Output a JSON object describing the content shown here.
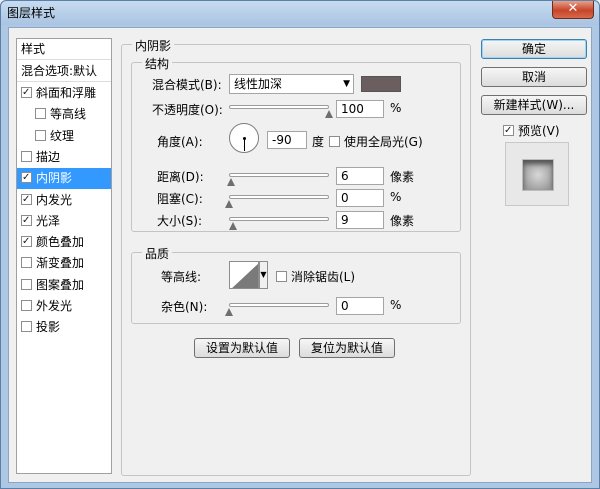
{
  "window": {
    "title": "图层样式",
    "close_glyph": "✕"
  },
  "style_list": {
    "header": "样式",
    "blend_options": "混合选项:默认",
    "items": [
      {
        "label": "斜面和浮雕",
        "checked": true
      },
      {
        "label": "等高线",
        "checked": false
      },
      {
        "label": "纹理",
        "checked": false
      },
      {
        "label": "描边",
        "checked": false
      },
      {
        "label": "内阴影",
        "checked": true
      },
      {
        "label": "内发光",
        "checked": true
      },
      {
        "label": "光泽",
        "checked": true
      },
      {
        "label": "颜色叠加",
        "checked": true
      },
      {
        "label": "渐变叠加",
        "checked": false
      },
      {
        "label": "图案叠加",
        "checked": false
      },
      {
        "label": "外发光",
        "checked": false
      },
      {
        "label": "投影",
        "checked": false
      }
    ]
  },
  "buttons": {
    "ok": "确定",
    "cancel": "取消",
    "new_style": "新建样式(W)...",
    "preview": "预览(V)",
    "preview_checked": true
  },
  "inner_shadow": {
    "title": "内阴影",
    "structure": {
      "title": "结构",
      "blend_mode_label": "混合模式(B):",
      "blend_mode_value": "线性加深",
      "shadow_color": "#6a5e5e",
      "opacity_label": "不透明度(O):",
      "opacity_value": "100",
      "opacity_fraction": 1.0,
      "opacity_unit": "%",
      "angle_label": "角度(A):",
      "angle_value": "-90",
      "angle_unit": "度",
      "global_light_label": "使用全局光(G)",
      "global_light_checked": false,
      "distance_label": "距离(D):",
      "distance_value": "6",
      "distance_fraction": 0.02,
      "distance_unit": "像素",
      "choke_label": "阻塞(C):",
      "choke_value": "0",
      "choke_fraction": 0.0,
      "choke_unit": "%",
      "size_label": "大小(S):",
      "size_value": "9",
      "size_fraction": 0.04,
      "size_unit": "像素"
    },
    "quality": {
      "title": "品质",
      "contour_label": "等高线:",
      "antialias_label": "消除锯齿(L)",
      "antialias_checked": false,
      "noise_label": "杂色(N):",
      "noise_value": "0",
      "noise_fraction": 0.0,
      "noise_unit": "%"
    },
    "set_default": "设置为默认值",
    "reset_default": "复位为默认值"
  }
}
